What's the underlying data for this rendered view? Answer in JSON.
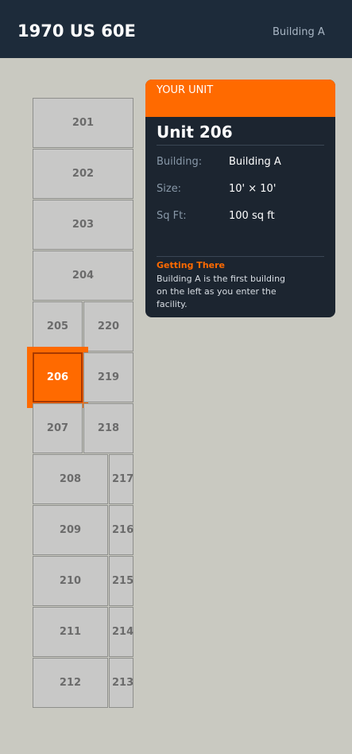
{
  "header": {
    "title": "1970 US 60E",
    "building": "Building A"
  },
  "units": {
    "u201": "201",
    "u202": "202",
    "u203": "203",
    "u204": "204",
    "u205": "205",
    "u206": "206",
    "u207": "207",
    "u208": "208",
    "u209": "209",
    "u210": "210",
    "u211": "211",
    "u212": "212",
    "u213": "213",
    "u214": "214",
    "u215": "215",
    "u216": "216",
    "u217": "217",
    "u218": "218",
    "u219": "219",
    "u220": "220"
  },
  "selected_unit": "206",
  "card": {
    "kicker": "YOUR UNIT",
    "title": "Unit 206",
    "building_label": "Building:",
    "building_value": "Building A",
    "size_label": "Size:",
    "size_value": "10' × 10'",
    "sqft_label": "Sq Ft:",
    "sqft_value": "100 sq ft",
    "getting_there_title": "Getting There",
    "getting_there_text": "Building A is the first building on the left as you enter the facility."
  },
  "colors": {
    "header_bg": "#1d2b3a",
    "accent": "#ff6a00",
    "card_bg": "#1c2530",
    "page_bg": "#c9c9c1",
    "unit_bg": "#c8c8c7"
  }
}
